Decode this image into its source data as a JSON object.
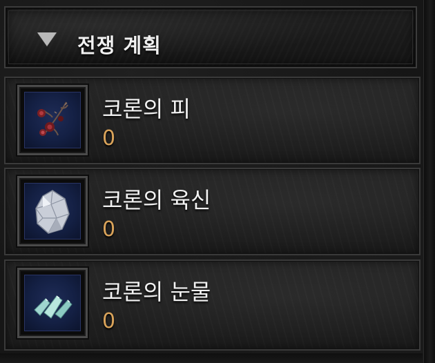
{
  "header": {
    "title": "전쟁 계획",
    "arrow_icon": "triangle-down-icon"
  },
  "items": [
    {
      "name": "코론의 피",
      "count": "0",
      "icon": "thorny-roses-icon"
    },
    {
      "name": "코론의 육신",
      "count": "0",
      "icon": "crystal-rock-icon"
    },
    {
      "name": "코론의 눈물",
      "count": "0",
      "icon": "crystal-shards-icon"
    }
  ],
  "colors": {
    "count_accent": "#d9a35a",
    "icon_background": "#142044",
    "title_text": "#f1f1f1"
  }
}
